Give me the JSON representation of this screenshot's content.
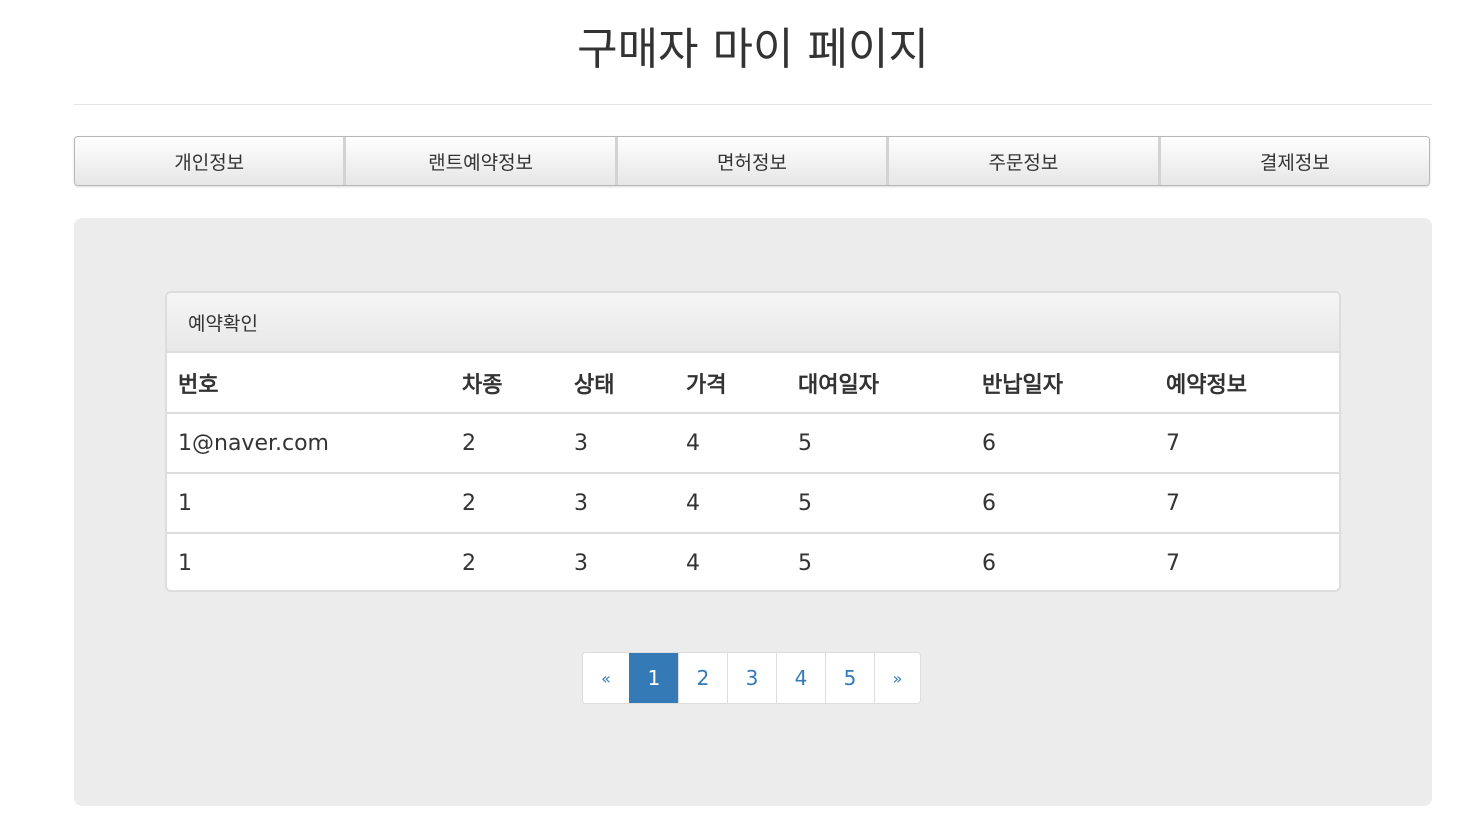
{
  "page": {
    "title": "구매자 마이 페이지"
  },
  "tabs": [
    {
      "label": "개인정보"
    },
    {
      "label": "랜트예약정보"
    },
    {
      "label": "면허정보"
    },
    {
      "label": "주문정보"
    },
    {
      "label": "결제정보"
    }
  ],
  "panel": {
    "heading": "예약확인",
    "columns": [
      "번호",
      "차종",
      "상태",
      "가격",
      "대여일자",
      "반납일자",
      "예약정보"
    ],
    "rows": [
      [
        "1@naver.com",
        "2",
        "3",
        "4",
        "5",
        "6",
        "7"
      ],
      [
        "1",
        "2",
        "3",
        "4",
        "5",
        "6",
        "7"
      ],
      [
        "1",
        "2",
        "3",
        "4",
        "5",
        "6",
        "7"
      ]
    ]
  },
  "pagination": {
    "prev": "«",
    "pages": [
      "1",
      "2",
      "3",
      "4",
      "5"
    ],
    "active": "1",
    "next": "»"
  },
  "colors": {
    "accent": "#337ab7",
    "well": "#ececec"
  }
}
